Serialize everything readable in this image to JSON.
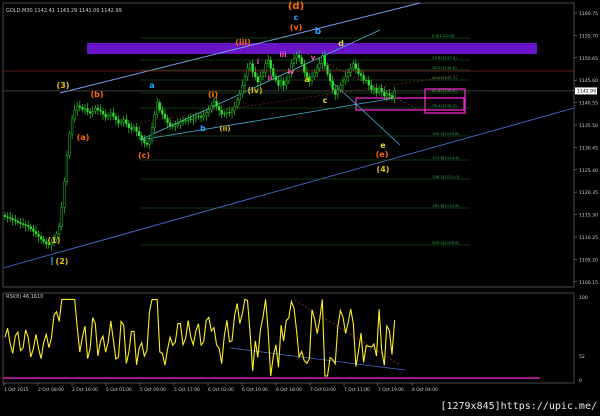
{
  "chart_data": {
    "type": "candlestick",
    "symbol_header": "GOLD,M30  1142.41 1143.29 1141.00 1142.99",
    "last_price": "1142.99",
    "price_axis_labels": [
      "1160.75",
      "1155.70",
      "1150.65",
      "1145.60",
      "1140.55",
      "1135.50",
      "1130.45",
      "1125.40",
      "1120.35",
      "1115.30",
      "1110.25",
      "1105.20",
      "1100.15"
    ],
    "time_axis_labels": [
      "1 Oct 2015",
      "2 Oct 08:00",
      "2 Oct 16:00",
      "5 Oct 01:00",
      "5 Oct 09:00",
      "5 Oct 17:00",
      "6 Oct 02:00",
      "6 Oct 10:00",
      "6 Oct 18:00",
      "7 Oct 03:00",
      "7 Oct 11:00",
      "7 Oct 19:00",
      "8 Oct 04:00"
    ],
    "fib_levels": [
      "0.0(1152.8)",
      "23.6(1147.4)",
      "38.2(1144.0)",
      "50.0(1141.3)",
      "61.8(1138.6)",
      "76.4(1135.3)",
      "100.0(1129.8)",
      "123.6(1124.4)",
      "138.2(1121.0)",
      "161.8(1115.6)",
      "200.0(1106.8)",
      "261.8(1092.6)"
    ],
    "wave_labels": [
      "(d)",
      "c",
      "(v)",
      "b",
      "d",
      "(iii)",
      "iii",
      "iv",
      "v",
      "i",
      "ii",
      "a",
      "c",
      "(3)",
      "(b)",
      "a",
      "(i)",
      "(iv)",
      "(a)",
      "b",
      "(ii)",
      "(c)",
      "e",
      "(e)",
      "(4)",
      "(1)",
      "(2)"
    ],
    "rsi_header": "RSI(8) 46.1610",
    "rsi_scale": [
      "100",
      "52",
      "0"
    ],
    "closes": [
      1113.8,
      1113.6,
      1113.4,
      1113.1,
      1112.8,
      1112.5,
      1112.2,
      1112.0,
      1111.8,
      1111.5,
      1111.0,
      1110.4,
      1109.8,
      1109.2,
      1108.6,
      1108.0,
      1107.5,
      1107.3,
      1107.8,
      1108.6,
      1109.8,
      1111.5,
      1116,
      1122,
      1128,
      1133,
      1136.5,
      1138.5,
      1139.5,
      1139.2,
      1138.7,
      1138.9,
      1138.2,
      1137.8,
      1138.3,
      1139.0,
      1138.6,
      1138.3,
      1137.6,
      1136.9,
      1137.3,
      1137.9,
      1137.1,
      1136.3,
      1135.5,
      1135.8,
      1136.3,
      1135.4,
      1134.5,
      1134.1,
      1134.6,
      1133.6,
      1132.6,
      1131.6,
      1130.9,
      1130.6,
      1131.6,
      1134.5,
      1137.6,
      1140.3,
      1138.6,
      1137.6,
      1136.6,
      1135.6,
      1134.9,
      1134.8,
      1135.1,
      1135.4,
      1135.8,
      1136.0,
      1136.2,
      1136.5,
      1136.4,
      1136.7,
      1137.0,
      1137.1,
      1136.9,
      1137.3,
      1137.9,
      1138.6,
      1139.6,
      1140.6,
      1139.4,
      1138.5,
      1137.6,
      1137.7,
      1138.0,
      1137.9,
      1138.4,
      1139.4,
      1140.9,
      1142.3,
      1144.3,
      1146.3,
      1148.3,
      1149.3,
      1147.3,
      1146.3,
      1145.1,
      1146.3,
      1147.3,
      1149.3,
      1150.1,
      1148.2,
      1146.4,
      1145.5,
      1144.3,
      1145.3,
      1144.3,
      1145.3,
      1147.3,
      1149.4,
      1150.5,
      1151.3,
      1150.7,
      1149.3,
      1147.3,
      1146.3,
      1145.3,
      1146.3,
      1147.3,
      1148.3,
      1149.4,
      1151.2,
      1148.9,
      1147.0,
      1145.3,
      1143.3,
      1142.2,
      1143.3,
      1144.3,
      1145.3,
      1146.3,
      1147.3,
      1148.3,
      1149.3,
      1148.2,
      1147.0,
      1146.6,
      1145.5,
      1145.5,
      1144.3,
      1143.3,
      1143.6,
      1142.6,
      1143.6,
      1142.8,
      1141.8,
      1142.3,
      1142.0,
      1141.3,
      1142.99
    ]
  }
}
